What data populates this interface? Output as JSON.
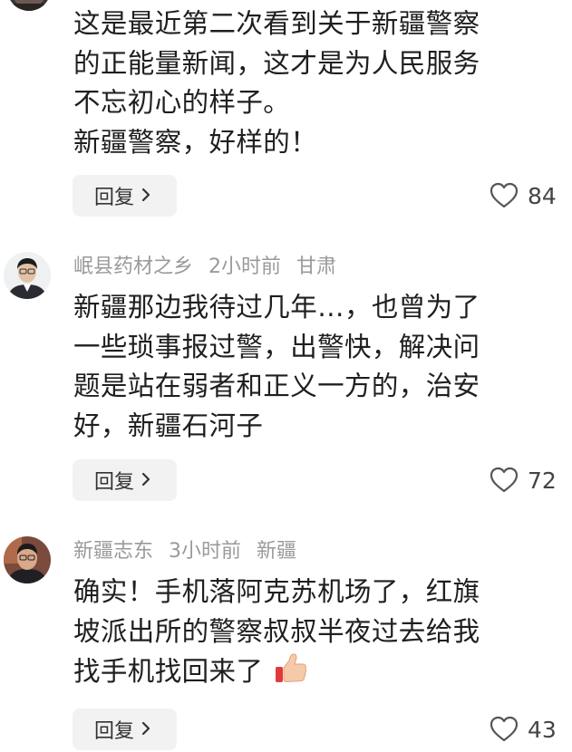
{
  "comments": [
    {
      "username": "",
      "time": "",
      "location": "",
      "lines": [
        "这是最近第二次看到关于新疆警察",
        "的正能量新闻，这才是为人民服务",
        "不忘初心的样子。",
        "新疆警察，好样的！"
      ],
      "reply_label": "回复",
      "likes": "84"
    },
    {
      "username": "岷县药材之乡",
      "time": "2小时前",
      "location": "甘肃",
      "lines": [
        "新疆那边我待过几年…，也曾为了",
        "一些琐事报过警，出警快，解决问",
        "题是站在弱者和正义一方的，治安",
        "好，新疆石河子"
      ],
      "reply_label": "回复",
      "likes": "72"
    },
    {
      "username": "新疆志东",
      "time": "3小时前",
      "location": "新疆",
      "lines": [
        "确实！手机落阿克苏机场了，红旗",
        "坡派出所的警察叔叔半夜过去给我",
        "找手机找回来了"
      ],
      "reply_label": "回复",
      "likes": "43"
    }
  ],
  "icons": {
    "reply_chevron": "chevron-right-icon",
    "like": "heart-outline-icon",
    "emoji": "thumbs-up-icon"
  },
  "colors": {
    "meta_text": "#9a9a9a",
    "body_text": "#1f1f1f",
    "reply_bg": "#f2f2f2"
  }
}
